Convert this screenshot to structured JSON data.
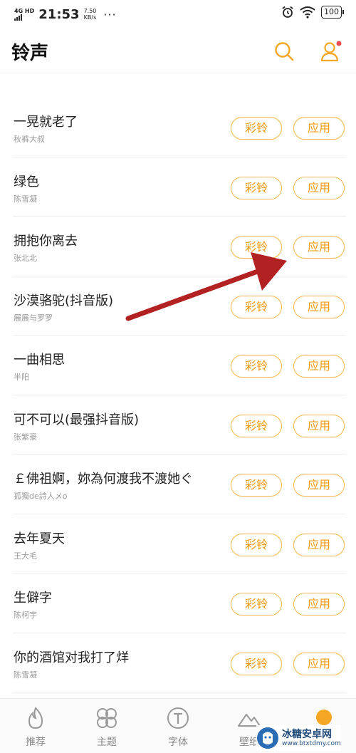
{
  "status": {
    "network": "4G HD",
    "time": "21:53",
    "speed_value": "7.50",
    "speed_unit": "KB/s",
    "more": "···",
    "battery": "100"
  },
  "header": {
    "title": "铃声",
    "search_icon": "search-icon",
    "account_icon": "user-icon",
    "accent": "#f5a623",
    "badge_color": "#e94c4c"
  },
  "buttons": {
    "color_ring": "彩铃",
    "apply": "应用"
  },
  "songs": [
    {
      "title": "一晃就老了",
      "artist": "秋裤大叔"
    },
    {
      "title": "绿色",
      "artist": "陈雪凝"
    },
    {
      "title": "拥抱你离去",
      "artist": "张北北"
    },
    {
      "title": "沙漠骆驼(抖音版)",
      "artist": "展展与罗罗"
    },
    {
      "title": "一曲相思",
      "artist": "半阳"
    },
    {
      "title": "可不可以(最强抖音版)",
      "artist": "张紫豪"
    },
    {
      "title": "￡佛祖婀，妳為何渡我不渡她ぐ",
      "artist": "孤獨de詩人メo"
    },
    {
      "title": "去年夏天",
      "artist": "王大毛"
    },
    {
      "title": "生僻字",
      "artist": "陈柯宇"
    },
    {
      "title": "你的酒馆对我打了烊",
      "artist": "陈雪凝"
    }
  ],
  "bottom_nav": [
    {
      "label": "推荐",
      "icon": "flame-icon"
    },
    {
      "label": "主题",
      "icon": "pinwheel-icon"
    },
    {
      "label": "字体",
      "icon": "font-icon"
    },
    {
      "label": "壁纸",
      "icon": "mountain-icon"
    },
    {
      "label": "",
      "icon": "ringtone-icon"
    }
  ],
  "annotation": {
    "color": "#b22222"
  },
  "watermark": {
    "name": "冰糖安卓网",
    "url": "www.btxtdmy.com"
  }
}
